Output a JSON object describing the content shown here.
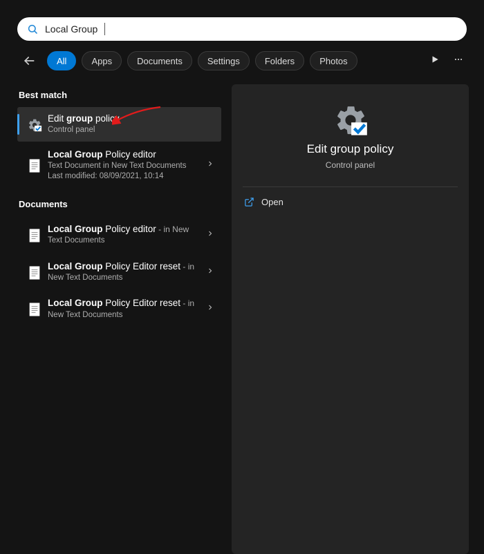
{
  "search": {
    "query": "Local Group"
  },
  "tabs": [
    "All",
    "Apps",
    "Documents",
    "Settings",
    "Folders",
    "Photos"
  ],
  "tabs_active_index": 0,
  "sections": {
    "best_match_label": "Best match",
    "documents_label": "Documents"
  },
  "results": {
    "best": [
      {
        "title_pre": "Edit ",
        "title_bold": "group",
        "title_post": " policy",
        "sub1": "Control panel"
      },
      {
        "title_pre": "",
        "title_bold": "Local Group",
        "title_post": " Policy editor",
        "sub1": "Text Document in New Text Documents",
        "sub2": "Last modified: 08/09/2021, 10:14"
      }
    ],
    "docs": [
      {
        "title_bold": "Local Group",
        "title_post": " Policy editor",
        "tail": " - in New Text Documents"
      },
      {
        "title_bold": "Local Group",
        "title_post": " Policy Editor reset",
        "tail": " - in New Text Documents"
      },
      {
        "title_bold": "Local Group",
        "title_post": " Policy Editor reset",
        "tail": " - in New Text Documents"
      }
    ]
  },
  "preview": {
    "title": "Edit group policy",
    "subtitle": "Control panel",
    "open_label": "Open"
  },
  "doc_label_in": "in"
}
